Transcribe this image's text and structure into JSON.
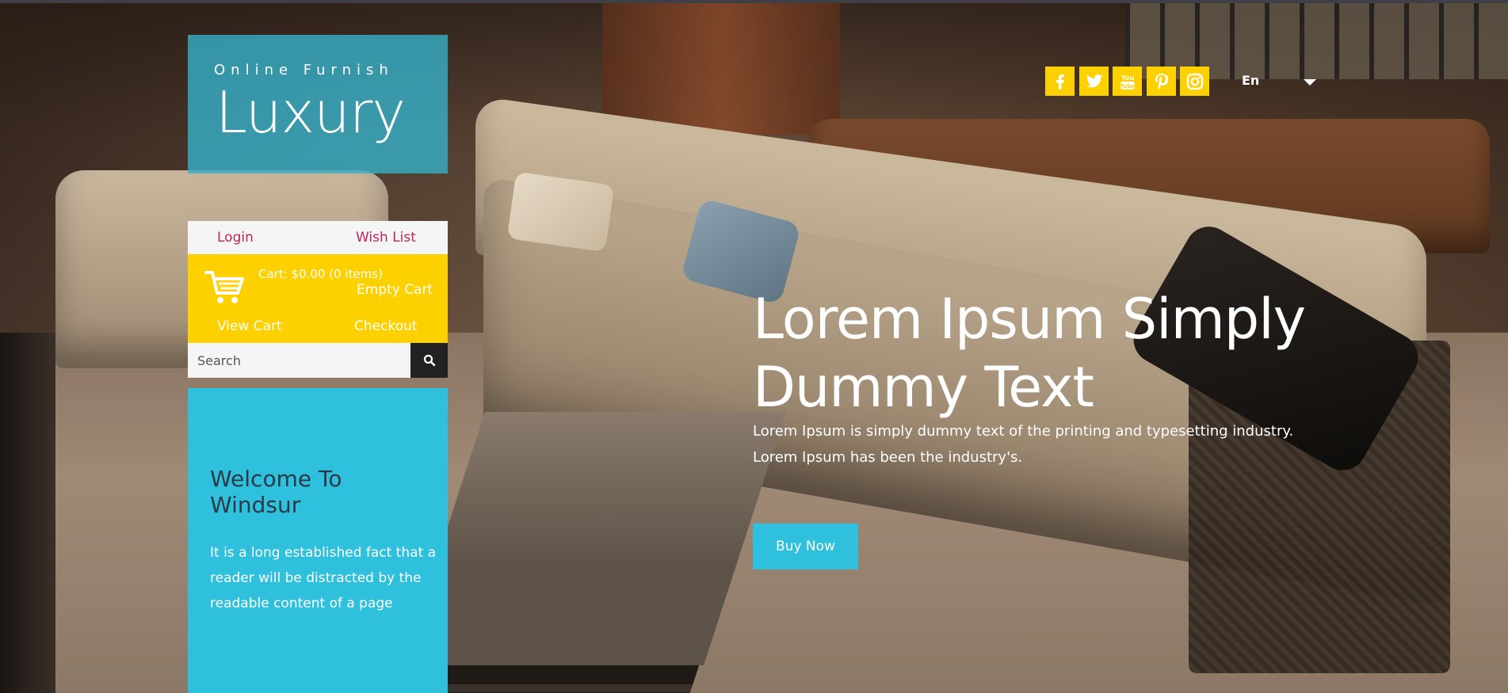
{
  "brand": {
    "tagline": "Online Furnish",
    "name": "Luxury"
  },
  "account": {
    "login_label": "Login",
    "wishlist_label": "Wish List"
  },
  "cart": {
    "summary": "Cart: $0.00 (0 items)",
    "empty_label": "Empty Cart",
    "view_label": "View Cart",
    "checkout_label": "Checkout"
  },
  "search": {
    "placeholder": "Search"
  },
  "welcome": {
    "title": "Welcome To Windsur",
    "text": "It is a long established fact that a reader will be distracted by the readable content of a page"
  },
  "social": [
    "facebook-icon",
    "twitter-icon",
    "youtube-icon",
    "pinterest-icon",
    "instagram-icon"
  ],
  "language": {
    "selected": "En"
  },
  "hero": {
    "title": "Lorem Ipsum Simply Dummy Text",
    "text": "Lorem Ipsum is simply dummy text of the printing and typesetting industry. Lorem Ipsum has been the industry's.",
    "cta_label": "Buy Now"
  },
  "colors": {
    "accent_cyan": "#2ec0dc",
    "accent_yellow": "#fdd000",
    "link_pink": "#c2255c"
  }
}
